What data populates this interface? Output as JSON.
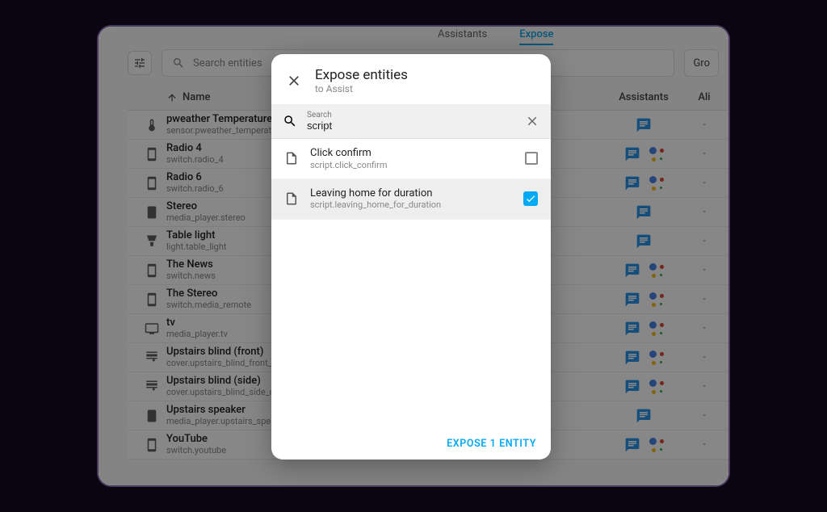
{
  "tabs": {
    "assistants": "Assistants",
    "expose": "Expose"
  },
  "toolbar": {
    "search_placeholder": "Search entities",
    "group_label": "Gro"
  },
  "table": {
    "header_name": "Name",
    "header_assistants": "Assistants",
    "header_aliases": "Ali",
    "rows": [
      {
        "icon": "thermometer",
        "title": "pweather Temperature",
        "sub": "sensor.pweather_temperature",
        "ga": false
      },
      {
        "icon": "cellphone",
        "title": "Radio 4",
        "sub": "switch.radio_4",
        "ga": true
      },
      {
        "icon": "cellphone",
        "title": "Radio 6",
        "sub": "switch.radio_6",
        "ga": true
      },
      {
        "icon": "speaker",
        "title": "Stereo",
        "sub": "media_player.stereo",
        "ga": false
      },
      {
        "icon": "light",
        "title": "Table light",
        "sub": "light.table_light",
        "ga": false
      },
      {
        "icon": "cellphone",
        "title": "The News",
        "sub": "switch.news",
        "ga": true
      },
      {
        "icon": "cellphone",
        "title": "The Stereo",
        "sub": "switch.media_remote",
        "ga": true
      },
      {
        "icon": "tv",
        "title": "tv",
        "sub": "media_player.tv",
        "ga": true
      },
      {
        "icon": "blinds",
        "title": "Upstairs blind (front)",
        "sub": "cover.upstairs_blind_front_cover",
        "ga": true
      },
      {
        "icon": "blinds",
        "title": "Upstairs blind (side)",
        "sub": "cover.upstairs_blind_side_cover",
        "ga": true
      },
      {
        "icon": "speaker",
        "title": "Upstairs speaker",
        "sub": "media_player.upstairs_speaker",
        "ga": false
      },
      {
        "icon": "cellphone",
        "title": "YouTube",
        "sub": "switch.youtube",
        "ga": true
      }
    ],
    "alias_placeholder": "-"
  },
  "modal": {
    "title": "Expose entities",
    "subtitle": "to Assist",
    "search_label": "Search",
    "search_value": "script",
    "items": [
      {
        "name": "Click confirm",
        "id": "script.click_confirm",
        "checked": false
      },
      {
        "name": "Leaving home for duration",
        "id": "script.leaving_home_for_duration",
        "checked": true
      }
    ],
    "action": "EXPOSE 1 ENTITY"
  }
}
